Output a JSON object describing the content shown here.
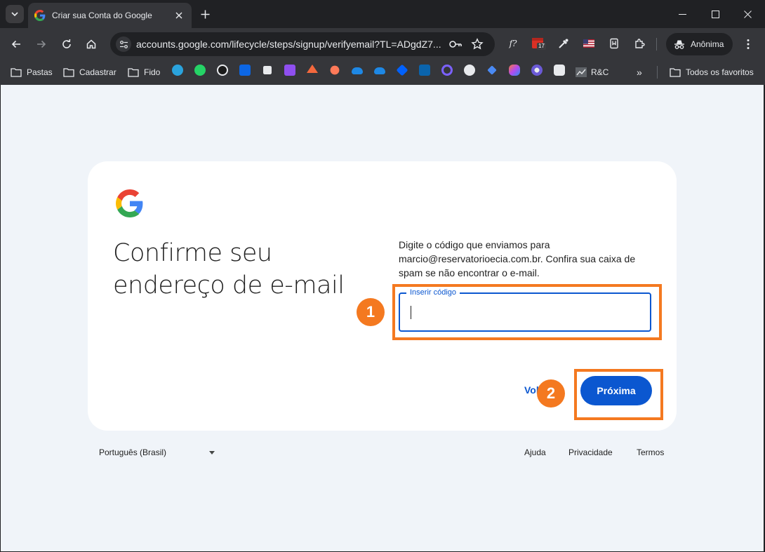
{
  "browser": {
    "tab_title": "Criar sua Conta do Google",
    "url": "accounts.google.com/lifecycle/steps/signup/verifyemail?TL=ADgdZ7...",
    "profile_label": "Anônima",
    "calendar_badge": "17",
    "formula_ext_label": "f?"
  },
  "bookmarks": {
    "items": [
      "Pastas",
      "Cadastrar",
      "Fido"
    ],
    "rc_label": "R&C",
    "overflow": "»",
    "all_label": "Todos os favoritos"
  },
  "page": {
    "heading": "Confirme seu endereço de e-mail",
    "description": "Digite o código que enviamos para marcio@reservatorioecia.com.br. Confira sua caixa de spam se não encontrar o e-mail.",
    "code_field": {
      "label": "Inserir código",
      "value": ""
    },
    "back_label": "Voltar",
    "next_label": "Próxima"
  },
  "callouts": [
    "1",
    "2"
  ],
  "footer": {
    "language": "Português (Brasil)",
    "links": [
      "Ajuda",
      "Privacidade",
      "Termos"
    ]
  },
  "colors": {
    "accent": "#0b57d0",
    "callout": "#f47920",
    "page_bg": "#f0f4f9",
    "chrome_bg": "#202124",
    "toolbar_bg": "#35363a"
  }
}
